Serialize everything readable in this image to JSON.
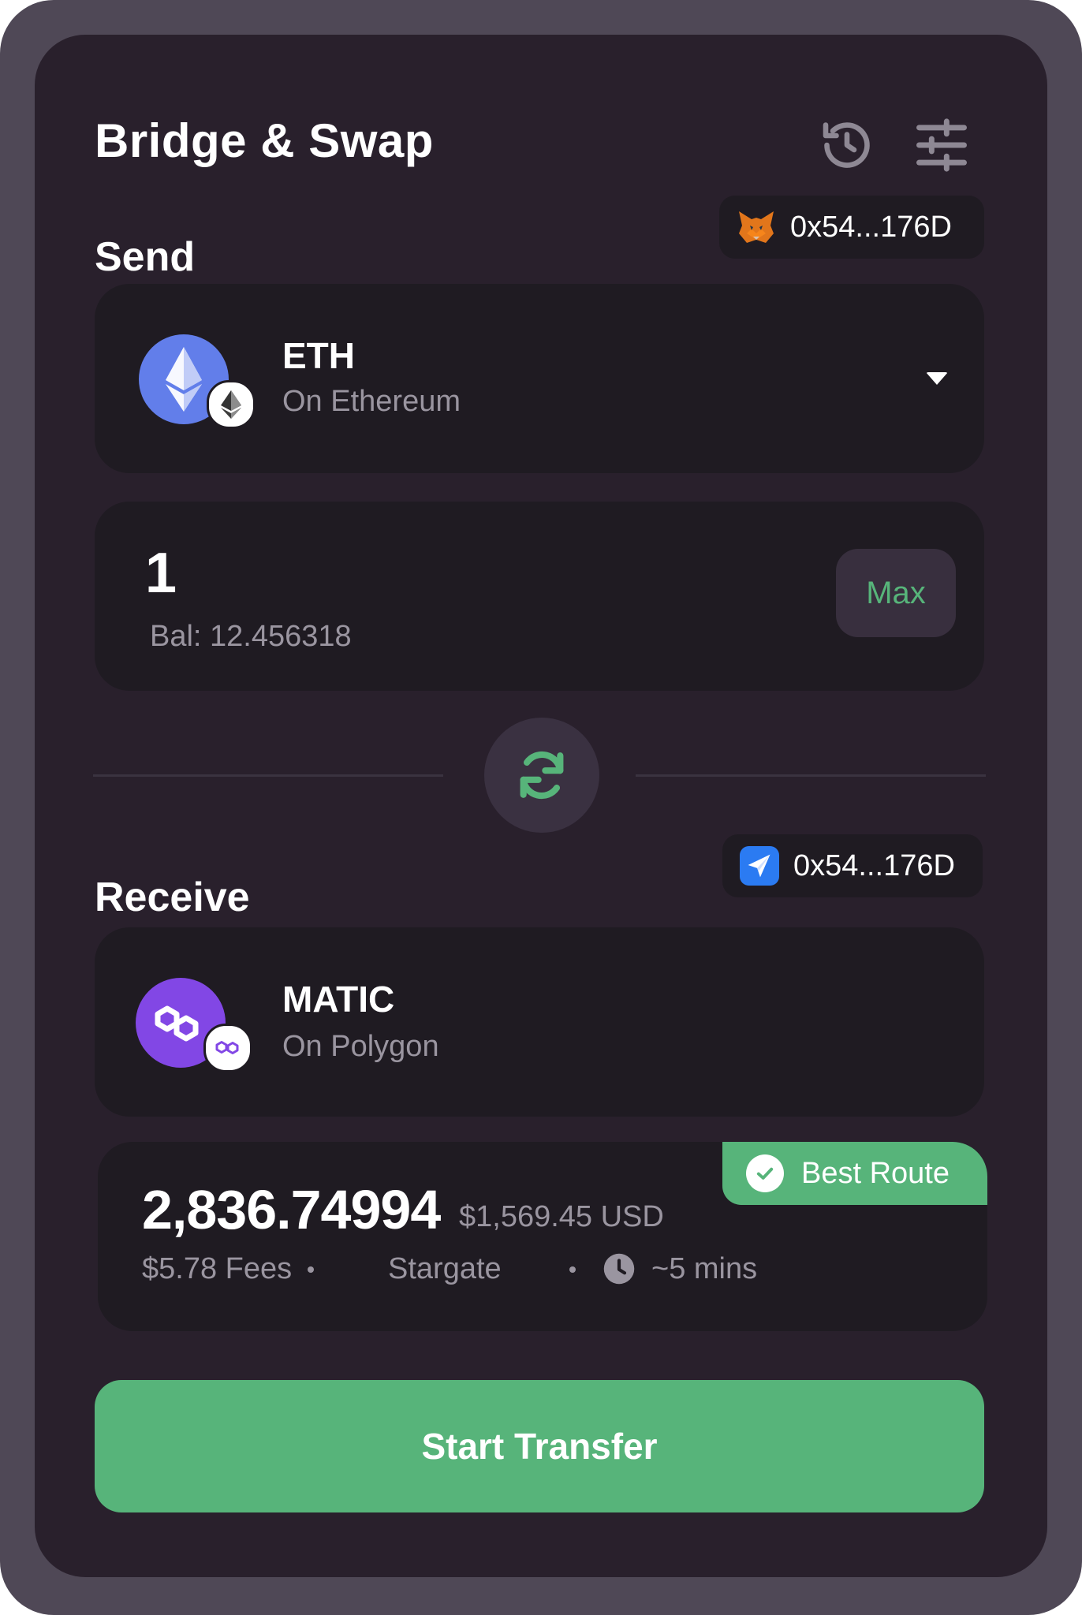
{
  "header": {
    "title": "Bridge & Swap",
    "history_icon": "history-icon",
    "settings_icon": "sliders-icon"
  },
  "send": {
    "label": "Send",
    "wallet": {
      "icon": "metamask-fox-icon",
      "address": "0x54...176D"
    },
    "token": {
      "symbol": "ETH",
      "chain": "On Ethereum",
      "logo": "ethereum-logo-icon",
      "chain_badge": "ethereum-chain-badge-icon"
    },
    "amount": "1",
    "balance": "Bal: 12.456318",
    "max_label": "Max"
  },
  "swap_icon": "swap-arrows-icon",
  "receive": {
    "label": "Receive",
    "wallet": {
      "icon": "send-plane-icon",
      "address": "0x54...176D"
    },
    "token": {
      "symbol": "MATIC",
      "chain": "On Polygon",
      "logo": "polygon-logo-icon",
      "chain_badge": "polygon-chain-badge-icon"
    },
    "amount": "2,836.74994",
    "usd_value": "$1,569.45 USD",
    "fees": "$5.78 Fees",
    "provider": "Stargate",
    "eta": "~5 mins",
    "badge": "Best Route"
  },
  "cta": {
    "label": "Start Transfer"
  },
  "colors": {
    "background": "#29202c",
    "panel": "#1f1b22",
    "accent": "#57b47a",
    "muted_text": "#9a95a0",
    "ethereum": "#627eea",
    "polygon": "#8247e5"
  }
}
